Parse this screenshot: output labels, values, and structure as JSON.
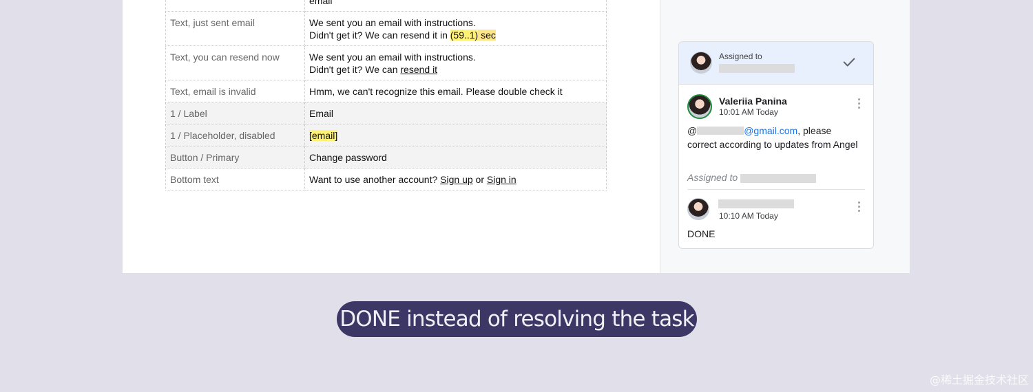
{
  "table": {
    "top_value": "email",
    "rows": [
      {
        "key": "Text, just sent email",
        "line1": "We sent you an email with instructions.",
        "line2_pre": "Didn't get it? We can resend it in ",
        "line2_timer": "(59..1)",
        "line2_suffix": " sec"
      },
      {
        "key": "Text, you can resend now",
        "line1": "We sent you an email with instructions.",
        "line2_pre": "Didn't get it? We can ",
        "line2_link": "resend it"
      },
      {
        "key": "Text, email is invalid",
        "value": "Hmm, we can't recognize this email. Please double check it"
      },
      {
        "key": "1 / Label",
        "value": "Email"
      },
      {
        "key": "1 / Placeholder, disabled",
        "value": "[email]"
      },
      {
        "key": "Button / Primary",
        "value": "Change password"
      },
      {
        "key": "Bottom text",
        "pre": "Want to use another account? ",
        "link1": "Sign up",
        "mid": " or ",
        "link2": "Sign in"
      }
    ]
  },
  "comment_thread": {
    "header": {
      "label": "Assigned to",
      "icon": "checkmark-icon"
    },
    "comments": [
      {
        "author": "Valeriia Panina",
        "time": "10:01 AM Today",
        "mention_prefix": "@",
        "mention_domain": "@gmail.com",
        "text_rest": ", please correct according to updates from Angel",
        "assigned_label": "Assigned to"
      },
      {
        "time": "10:10 AM Today",
        "text": "DONE"
      }
    ]
  },
  "caption": "DONE instead of resolving the task",
  "watermark": "@稀土掘金技术社区",
  "colors": {
    "caption_bg": "#3d3766",
    "page_bg": "#e0dfea",
    "thread_header_bg": "#e8f0fe",
    "link": "#1a73e8"
  }
}
